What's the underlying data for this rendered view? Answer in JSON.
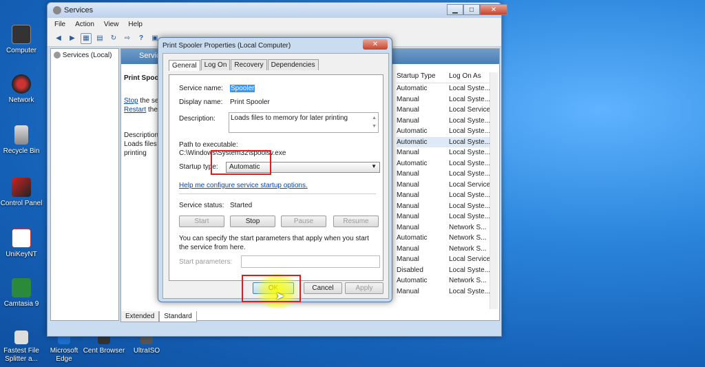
{
  "desktop": {
    "icons": [
      {
        "label": "Computer"
      },
      {
        "label": "Network"
      },
      {
        "label": "Recycle Bin"
      },
      {
        "label": "Control Panel"
      },
      {
        "label": "UniKeyNT"
      },
      {
        "label": "Camtasia 9"
      },
      {
        "label": "Fastest File Splitter a..."
      },
      {
        "label": "Microsoft Edge"
      },
      {
        "label": "Cent Browser"
      },
      {
        "label": "UltraISO"
      }
    ]
  },
  "services_window": {
    "title": "Services",
    "menu": [
      "File",
      "Action",
      "View",
      "Help"
    ],
    "tree_item": "Services (Local)",
    "panel_header": "Servic",
    "desc": {
      "service_title": "Print Spool",
      "stop_link": "Stop",
      "stop_rest": " the se",
      "restart_link": "Restart",
      "restart_rest": " the",
      "description_label": "Description",
      "description_text1": "Loads files t",
      "description_text2": "printing"
    },
    "columns": {
      "startup_type": "Startup Type",
      "log_on_as": "Log On As"
    },
    "rows": [
      {
        "startup": "Automatic",
        "logon": "Local Syste..."
      },
      {
        "startup": "Manual",
        "logon": "Local Syste..."
      },
      {
        "startup": "Manual",
        "logon": "Local Service"
      },
      {
        "startup": "Manual",
        "logon": "Local Syste..."
      },
      {
        "startup": "Automatic",
        "logon": "Local Syste..."
      },
      {
        "startup": "Automatic",
        "logon": "Local Syste..."
      },
      {
        "startup": "Manual",
        "logon": "Local Syste..."
      },
      {
        "startup": "Automatic",
        "logon": "Local Syste..."
      },
      {
        "startup": "Manual",
        "logon": "Local Syste..."
      },
      {
        "startup": "Manual",
        "logon": "Local Service"
      },
      {
        "startup": "Manual",
        "logon": "Local Syste..."
      },
      {
        "startup": "Manual",
        "logon": "Local Syste..."
      },
      {
        "startup": "Manual",
        "logon": "Local Syste..."
      },
      {
        "startup": "Manual",
        "logon": "Network S..."
      },
      {
        "startup": "Automatic",
        "logon": "Network S..."
      },
      {
        "startup": "Manual",
        "logon": "Network S..."
      },
      {
        "startup": "Manual",
        "logon": "Local Service"
      },
      {
        "startup": "Disabled",
        "logon": "Local Syste..."
      },
      {
        "startup": "Automatic",
        "logon": "Network S..."
      },
      {
        "startup": "Manual",
        "logon": "Local Syste..."
      }
    ],
    "bottom_tabs": [
      "Extended",
      "Standard"
    ]
  },
  "dialog": {
    "title": "Print Spooler Properties (Local Computer)",
    "close": "✕",
    "tabs": [
      "General",
      "Log On",
      "Recovery",
      "Dependencies"
    ],
    "service_name_label": "Service name:",
    "service_name_value": "Spooler",
    "display_name_label": "Display name:",
    "display_name_value": "Print Spooler",
    "description_label": "Description:",
    "description_value": "Loads files to memory for later printing",
    "path_label": "Path to executable:",
    "path_value": "C:\\Windows\\System32\\spoolsv.exe",
    "startup_type_label": "Startup type:",
    "startup_type_value": "Automatic",
    "help_link": "Help me configure service startup options.",
    "status_label": "Service status:",
    "status_value": "Started",
    "buttons": {
      "start": "Start",
      "stop": "Stop",
      "pause": "Pause",
      "resume": "Resume"
    },
    "params_note": "You can specify the start parameters that apply when you start the service from here.",
    "params_label": "Start parameters:",
    "ok": "OK",
    "cancel": "Cancel",
    "apply": "Apply"
  },
  "colors": {
    "highlight": "#e01b1b",
    "selection": "#3399ff",
    "link": "#0645ad"
  }
}
